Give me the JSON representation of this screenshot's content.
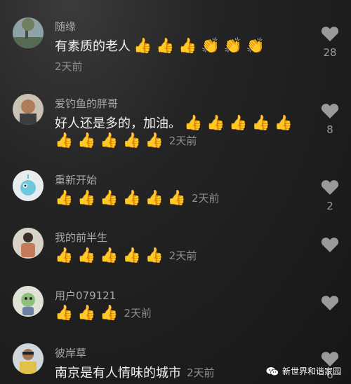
{
  "comments": [
    {
      "username": "随缘",
      "text": "有素质的老人",
      "emojis": [
        "👍",
        "👍",
        "👍",
        "👏",
        "👏",
        "👏"
      ],
      "time": "2天前",
      "likes": "28",
      "avatar_icon": "landscape-avatar"
    },
    {
      "username": "爱钓鱼的胖哥",
      "text": "好人还是多的，加油。",
      "emojis_line1": [
        "👍",
        "👍",
        "👍",
        "👍",
        "👍"
      ],
      "emojis_line2": [
        "👍",
        "👍",
        "👍",
        "👍",
        "👍"
      ],
      "time": "2天前",
      "likes": "8",
      "avatar_icon": "man-photo-avatar"
    },
    {
      "username": "重新开始",
      "emojis": [
        "👍",
        "👍",
        "👍",
        "👍",
        "👍",
        "👍"
      ],
      "time": "2天前",
      "likes": "2",
      "avatar_icon": "cartoon-avatar"
    },
    {
      "username": "我的前半生",
      "emojis": [
        "👍",
        "👍",
        "👍",
        "👍",
        "👍"
      ],
      "time": "2天前",
      "likes": "",
      "avatar_icon": "person-avatar"
    },
    {
      "username": "用户079121",
      "emojis": [
        "👍",
        "👍",
        "👍"
      ],
      "time": "2天前",
      "likes": "",
      "avatar_icon": "cartoon-avatar"
    },
    {
      "username": "彼岸草",
      "text": "南京是有人情味的城市",
      "time": "2天前",
      "likes": "6",
      "avatar_icon": "man-photo-avatar"
    }
  ],
  "watermark": {
    "text": "新世界和谐家园",
    "icon": "wechat-icon"
  },
  "colors": {
    "background": "#1c1c1c",
    "username": "#a9a9a9",
    "text": "#f2f2f2",
    "time": "#8e8e8e",
    "heart": "#9a9a9a"
  }
}
